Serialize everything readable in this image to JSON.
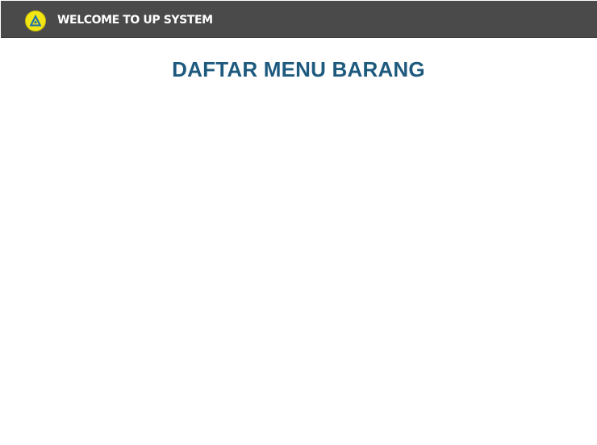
{
  "header": {
    "logo_icon": "app-logo-icon",
    "welcome_text": "WELCOME TO UP SYSTEM",
    "background_color": "#4a4a4a"
  },
  "main": {
    "title": "DAFTAR MENU BARANG",
    "title_color": "#1e5a7e"
  }
}
